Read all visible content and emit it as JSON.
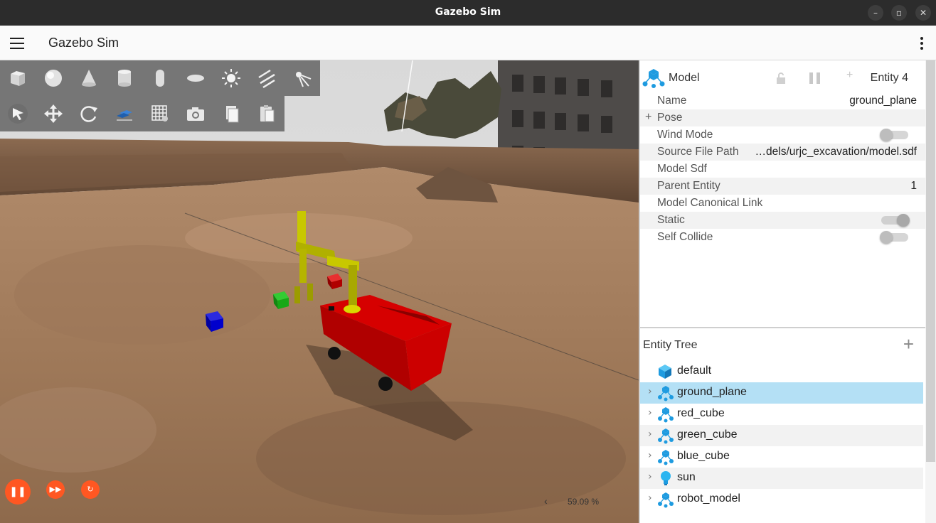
{
  "window": {
    "title": "Gazebo Sim",
    "minimize_glyph": "–",
    "maximize_glyph": "▫",
    "close_glyph": "✕"
  },
  "appbar": {
    "title": "Gazebo Sim",
    "menu_icon": "hamburger-icon",
    "overflow_icon": "kebab-icon"
  },
  "toolbar": {
    "shapes": [
      "box-icon",
      "sphere-icon",
      "cone-icon",
      "cylinder-icon",
      "capsule-icon",
      "ellipsoid-icon",
      "sun-icon",
      "directional-light-icon",
      "spot-light-icon"
    ],
    "transform": [
      "select-arrow-icon",
      "translate-icon",
      "rotate-icon",
      "align-icon",
      "grid-snap-icon",
      "screenshot-camera-icon",
      "copy-icon",
      "paste-icon"
    ]
  },
  "playback": {
    "pause_glyph": "❚❚",
    "step_glyph": "▶▶",
    "reset_glyph": "↻",
    "color": "#ff5722"
  },
  "scene": {
    "zoom_chevron": "‹",
    "zoom_value": "59.09 %"
  },
  "component_inspector": {
    "type_label": "Model",
    "entity_label": "Entity 4",
    "plus_glyph": "+",
    "rows": [
      {
        "key": "Name",
        "value": "ground_plane"
      },
      {
        "key": "Pose",
        "value": "",
        "expandable": true,
        "expand_glyph": "+"
      },
      {
        "key": "Wind Mode",
        "toggle": false
      },
      {
        "key": "Source File Path",
        "value": "…dels/urjc_excavation/model.sdf"
      },
      {
        "key": "Model Sdf",
        "value": ""
      },
      {
        "key": "Parent Entity",
        "value": "1"
      },
      {
        "key": "Model Canonical Link",
        "value": ""
      },
      {
        "key": "Static",
        "toggle": true
      },
      {
        "key": "Self Collide",
        "toggle": false
      }
    ]
  },
  "entity_tree": {
    "title": "Entity Tree",
    "add_glyph": "+",
    "chevron_glyph": "›",
    "items": [
      {
        "name": "default",
        "icon": "world-cube-icon",
        "expandable": false,
        "selected": false
      },
      {
        "name": "ground_plane",
        "icon": "model-icon",
        "expandable": true,
        "selected": true
      },
      {
        "name": "red_cube",
        "icon": "model-icon",
        "expandable": true,
        "selected": false
      },
      {
        "name": "green_cube",
        "icon": "model-icon",
        "expandable": true,
        "selected": false
      },
      {
        "name": "blue_cube",
        "icon": "model-icon",
        "expandable": true,
        "selected": false
      },
      {
        "name": "sun",
        "icon": "light-bulb-icon",
        "expandable": true,
        "selected": false
      },
      {
        "name": "robot_model",
        "icon": "model-icon",
        "expandable": true,
        "selected": false
      }
    ]
  },
  "colors": {
    "accent": "#ff5722",
    "selection": "#b4e0f5",
    "icon_blue": "#1e9be0"
  }
}
